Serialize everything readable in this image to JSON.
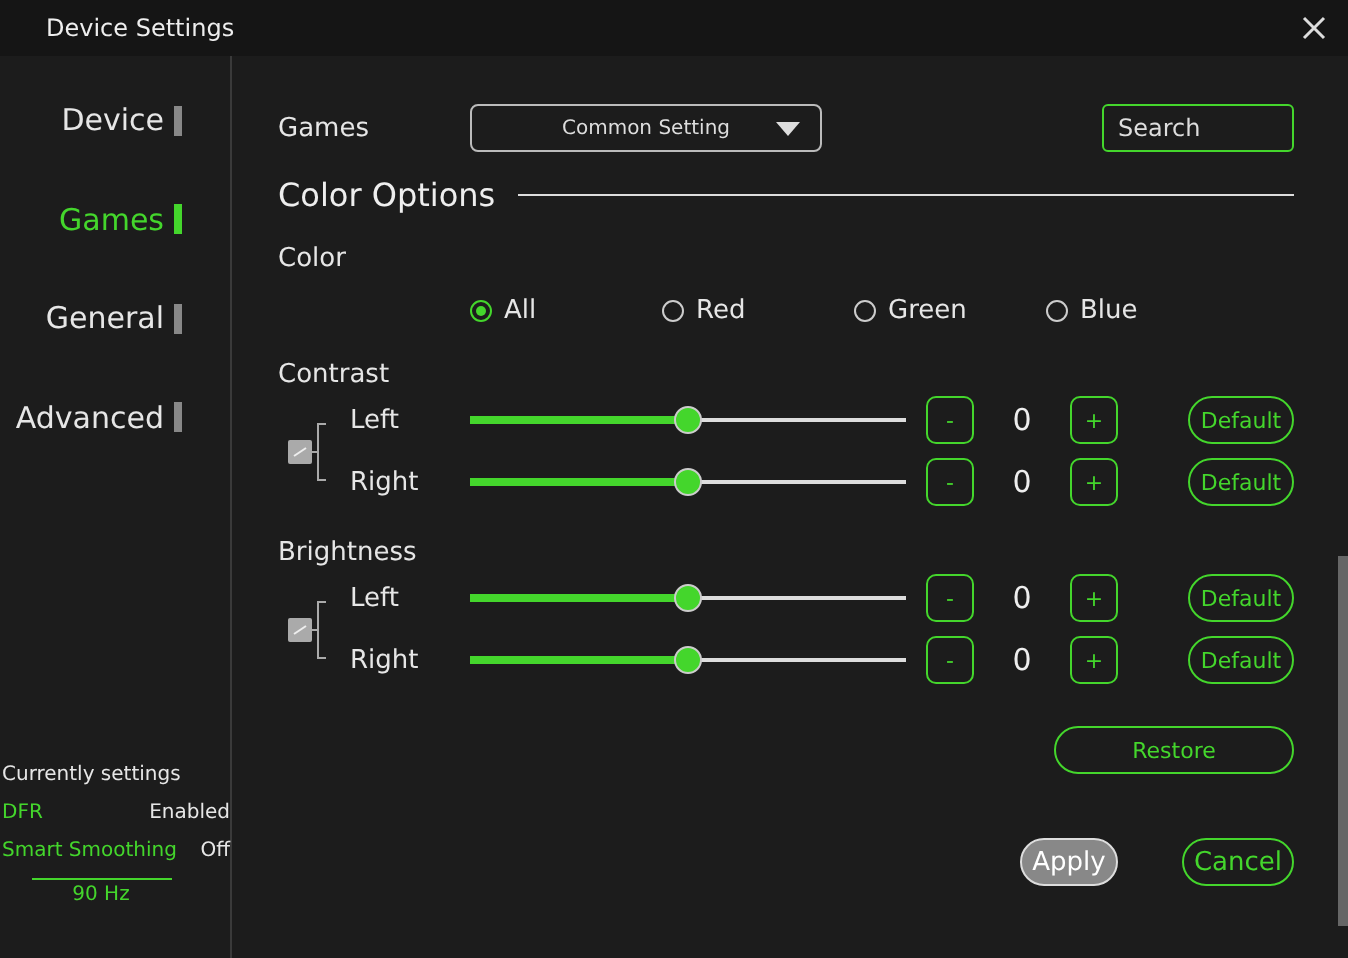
{
  "window": {
    "title": "Device Settings"
  },
  "sidebar": {
    "items": [
      {
        "label": "Device",
        "selected": false
      },
      {
        "label": "Games",
        "selected": true
      },
      {
        "label": "General",
        "selected": false
      },
      {
        "label": "Advanced",
        "selected": false
      }
    ],
    "current": {
      "title": "Currently settings",
      "rows": [
        {
          "name": "DFR",
          "value": "Enabled"
        },
        {
          "name": "Smart Smoothing",
          "value": "Off"
        }
      ],
      "refresh": "90 Hz"
    }
  },
  "games": {
    "label": "Games",
    "dropdown": "Common Setting",
    "search": {
      "placeholder": "Search"
    }
  },
  "section": {
    "title": "Color Options"
  },
  "color": {
    "label": "Color",
    "options": [
      {
        "label": "All",
        "selected": true
      },
      {
        "label": "Red",
        "selected": false
      },
      {
        "label": "Green",
        "selected": false
      },
      {
        "label": "Blue",
        "selected": false
      }
    ]
  },
  "groups": [
    {
      "label": "Contrast",
      "linked": true,
      "rows": [
        {
          "label": "Left",
          "level": 0.5,
          "value": "0",
          "minus": "-",
          "plus": "+",
          "default": "Default"
        },
        {
          "label": "Right",
          "level": 0.5,
          "value": "0",
          "minus": "-",
          "plus": "+",
          "default": "Default"
        }
      ]
    },
    {
      "label": "Brightness",
      "linked": true,
      "rows": [
        {
          "label": "Left",
          "level": 0.5,
          "value": "0",
          "minus": "-",
          "plus": "+",
          "default": "Default"
        },
        {
          "label": "Right",
          "level": 0.5,
          "value": "0",
          "minus": "-",
          "plus": "+",
          "default": "Default"
        }
      ]
    }
  ],
  "restore": "Restore",
  "apply": {
    "label": "Apply",
    "disabled": true
  },
  "cancel": "Cancel"
}
